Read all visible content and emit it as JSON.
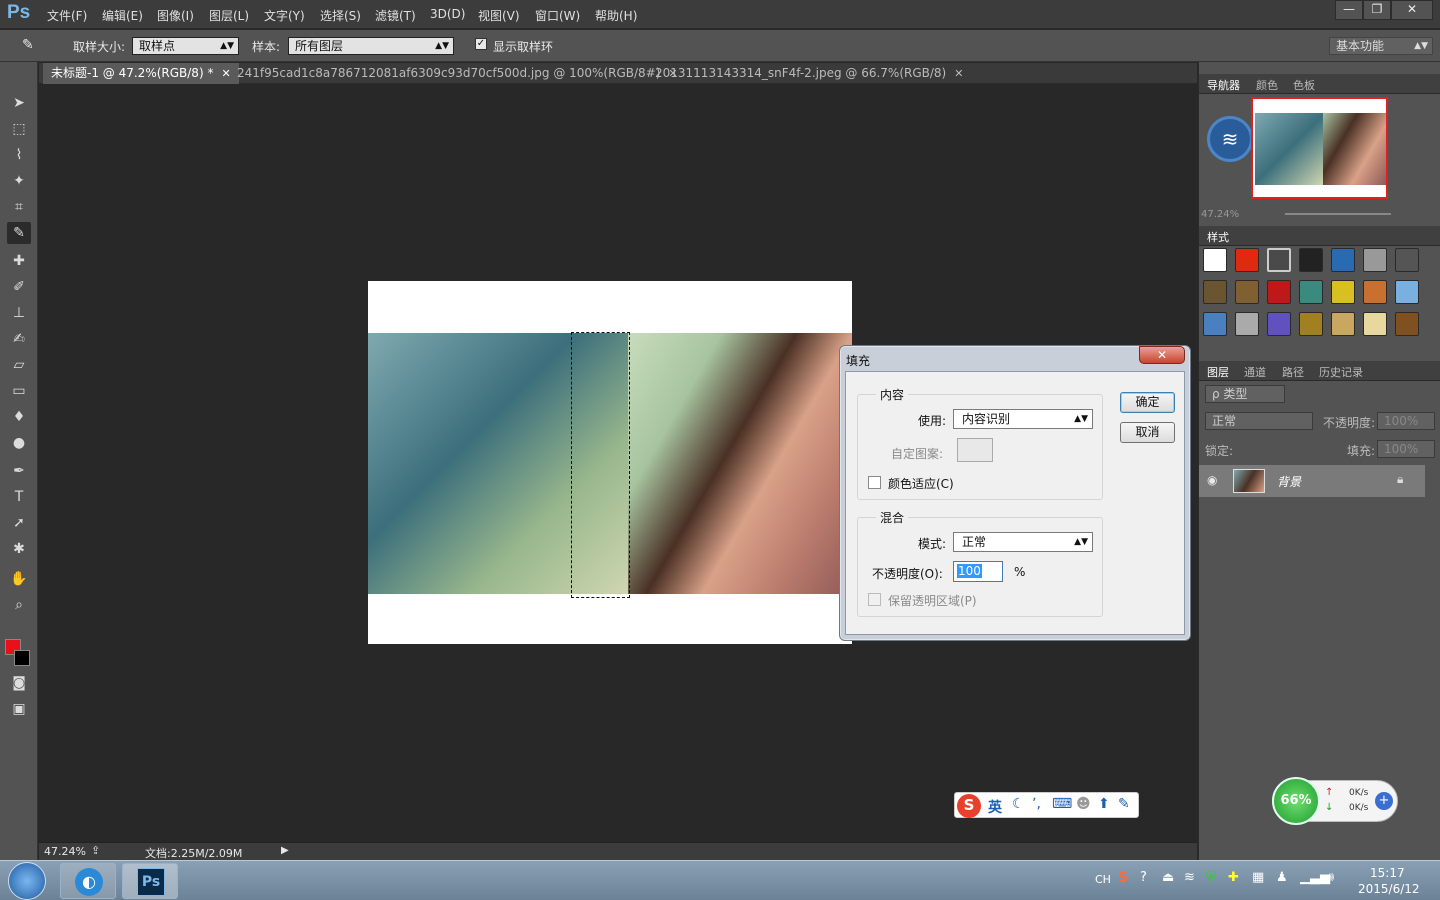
{
  "app": {
    "logo": "Ps"
  },
  "menu": [
    "文件(F)",
    "编辑(E)",
    "图像(I)",
    "图层(L)",
    "文字(Y)",
    "选择(S)",
    "滤镜(T)",
    "3D(D)",
    "视图(V)",
    "窗口(W)",
    "帮助(H)"
  ],
  "window_controls": {
    "minimize": "—",
    "restore": "❐",
    "close": "✕"
  },
  "options": {
    "sample_size_label": "取样大小:",
    "sample_size_value": "取样点",
    "sample_label": "样本:",
    "sample_value": "所有图层",
    "show_ring_label": "显示取样环",
    "show_ring_checked": true,
    "workspace": "基本功能"
  },
  "tabs": [
    {
      "label": "未标题-1 @ 47.2%(RGB/8) *",
      "active": true
    },
    {
      "label": "241f95cad1c8a786712081af6309c93d70cf500d.jpg @ 100%(RGB/8#)",
      "active": false
    },
    {
      "label": "20131113143314_snF4f-2.jpeg @ 66.7%(RGB/8)",
      "active": false
    }
  ],
  "status": {
    "zoom": "47.24%",
    "doc": "文档:2.25M/2.09M"
  },
  "colors": {
    "foreground": "#e8101a",
    "background": "#000000"
  },
  "panels": {
    "navigator_tabs": [
      "导航器",
      "颜色",
      "色板"
    ],
    "navigator_zoom": "47.24%",
    "styles_tab": "样式",
    "layers_tabs": [
      "图层",
      "通道",
      "路径",
      "历史记录"
    ],
    "layer_filter": "ρ 类型",
    "blend_mode": "正常",
    "opacity_label": "不透明度:",
    "opacity_value": "100%",
    "lock_label": "锁定:",
    "fill_label": "填充:",
    "fill_value": "100%",
    "layer_name": "背景"
  },
  "dialog": {
    "title": "填充",
    "close": "✕",
    "content_group": "内容",
    "use_label": "使用:",
    "use_value": "内容识别",
    "custom_pattern_label": "自定图案:",
    "color_adapt_label": "颜色适应(C)",
    "blend_group": "混合",
    "mode_label": "模式:",
    "mode_value": "正常",
    "opacity_label": "不透明度(O):",
    "opacity_value": "100",
    "percent": "%",
    "preserve_label": "保留透明区域(P)",
    "ok": "确定",
    "cancel": "取消"
  },
  "ime": {
    "lang": "英"
  },
  "netmeter": {
    "percent": "66%",
    "up": "0K/s",
    "down": "0K/s"
  },
  "taskbar": {
    "time": "15:17",
    "date": "2015/6/12",
    "lang": "CH"
  }
}
